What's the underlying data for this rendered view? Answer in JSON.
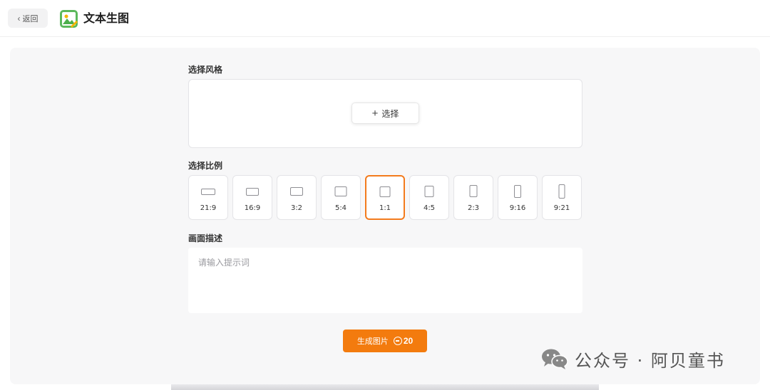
{
  "header": {
    "back_label": "返回",
    "title": "文本生图"
  },
  "style_section": {
    "label": "选择风格",
    "select_button": "选择"
  },
  "ratio_section": {
    "label": "选择比例",
    "selected": "1:1",
    "options": [
      "21:9",
      "16:9",
      "3:2",
      "5:4",
      "1:1",
      "4:5",
      "2:3",
      "9:16",
      "9:21"
    ]
  },
  "description_section": {
    "label": "画面描述",
    "placeholder": "请输入提示词",
    "value": ""
  },
  "generate_button": {
    "label": "生成图片",
    "cost": "20"
  },
  "watermark": {
    "text": "公众号 · 阿贝童书"
  },
  "colors": {
    "accent": "#f37b0e",
    "selected_border": "#f37b1d",
    "panel_bg": "#f7f7f8"
  }
}
